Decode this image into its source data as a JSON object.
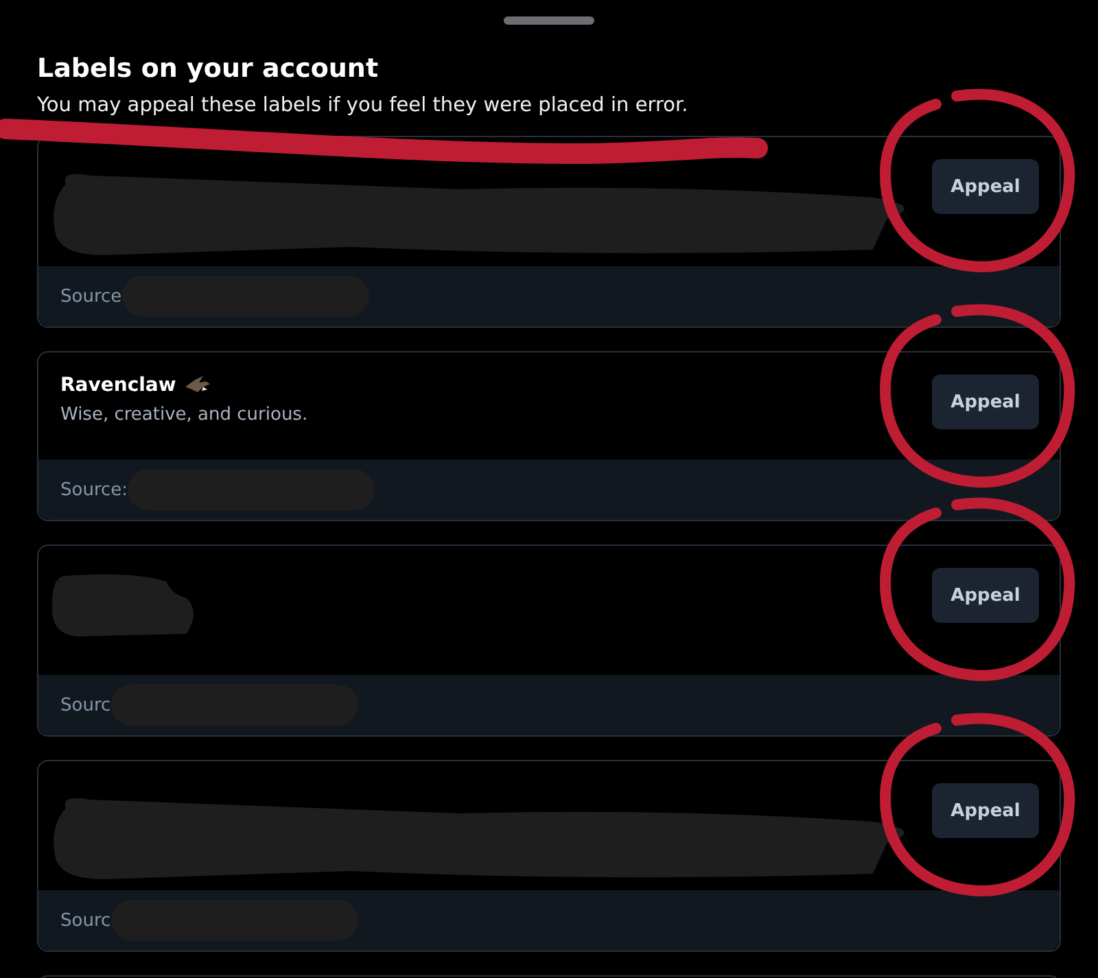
{
  "sheet": {
    "title": "Labels on your account",
    "subtitle": "You may appeal these labels if you feel they were placed in error.",
    "subtitle_struck": true
  },
  "labels": [
    {
      "kind": "hiddenwide",
      "source": "Source",
      "source_redacted": true,
      "button": "Appeal",
      "circled": true
    },
    {
      "kind": "named",
      "name": "Ravenclaw",
      "description": "Wise, creative, and curious.",
      "source": "Source:",
      "source_redacted": true,
      "button": "Appeal",
      "circled": true
    },
    {
      "kind": "hiddennarrow",
      "source": "Sourc",
      "source_redacted": true,
      "button": "Appeal",
      "circled": true
    },
    {
      "kind": "hiddenwide",
      "source": "Sourc",
      "source_redacted": true,
      "button": "Appeal",
      "circled": true
    }
  ]
}
